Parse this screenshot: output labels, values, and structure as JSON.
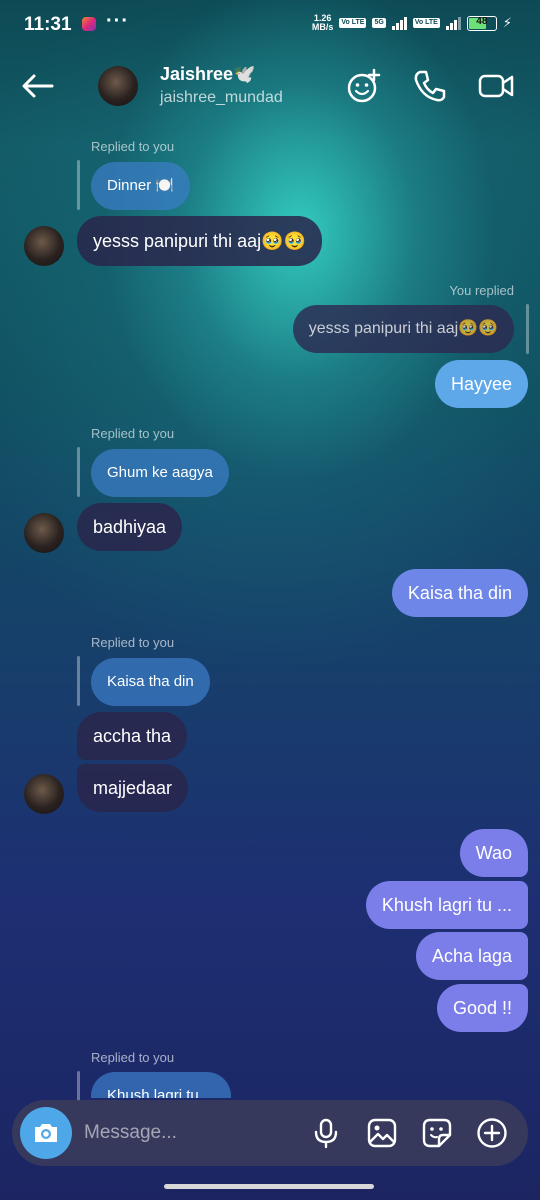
{
  "status": {
    "time": "11:31",
    "net_speed": "1.26",
    "net_unit": "MB/s",
    "vo_lte_1": "Vo LTE",
    "network_5g": "5G",
    "vo_lte_2": "Vo LTE",
    "battery": "48"
  },
  "header": {
    "name": "Jaishree🕊️",
    "username": "jaishree_mundad",
    "icons": [
      "back-arrow-icon",
      "add-effect-icon",
      "phone-icon",
      "video-icon"
    ]
  },
  "messages": [
    {
      "type": "reply_label",
      "text": "Replied to you"
    },
    {
      "type": "quoted",
      "text": "Dinner 🍽️"
    },
    {
      "type": "incoming",
      "text": "yesss panipuri thi aaj🥹🥹"
    },
    {
      "type": "reply_label_out",
      "text": "You replied"
    },
    {
      "type": "quoted_out",
      "text": "yesss panipuri thi aaj🥹🥹"
    },
    {
      "type": "outgoing",
      "text": "Hayyee"
    },
    {
      "type": "reply_label",
      "text": "Replied to you"
    },
    {
      "type": "quoted",
      "text": "Ghum ke aagya"
    },
    {
      "type": "incoming",
      "text": "badhiyaa"
    },
    {
      "type": "outgoing",
      "text": "Kaisa tha din"
    },
    {
      "type": "reply_label",
      "text": "Replied to you"
    },
    {
      "type": "quoted",
      "text": "Kaisa tha din"
    },
    {
      "type": "incoming",
      "text": "accha tha"
    },
    {
      "type": "incoming",
      "text": "majjedaar"
    },
    {
      "type": "outgoing",
      "text": "Wao"
    },
    {
      "type": "outgoing",
      "text": "Khush lagri tu ..."
    },
    {
      "type": "outgoing",
      "text": "Acha laga"
    },
    {
      "type": "outgoing",
      "text": "Good !!"
    },
    {
      "type": "reply_label",
      "text": "Replied to you"
    },
    {
      "type": "quoted",
      "text": "Khush lagri tu ..."
    }
  ],
  "composer": {
    "placeholder": "Message...",
    "icons": [
      "camera-icon",
      "mic-icon",
      "gallery-icon",
      "sticker-icon",
      "add-icon"
    ]
  },
  "colors": {
    "outgoing_top": "#5ea8ea",
    "outgoing_bottom": "#7b7ee9",
    "incoming": "#2a264c",
    "camera_button": "#4da7e8"
  }
}
